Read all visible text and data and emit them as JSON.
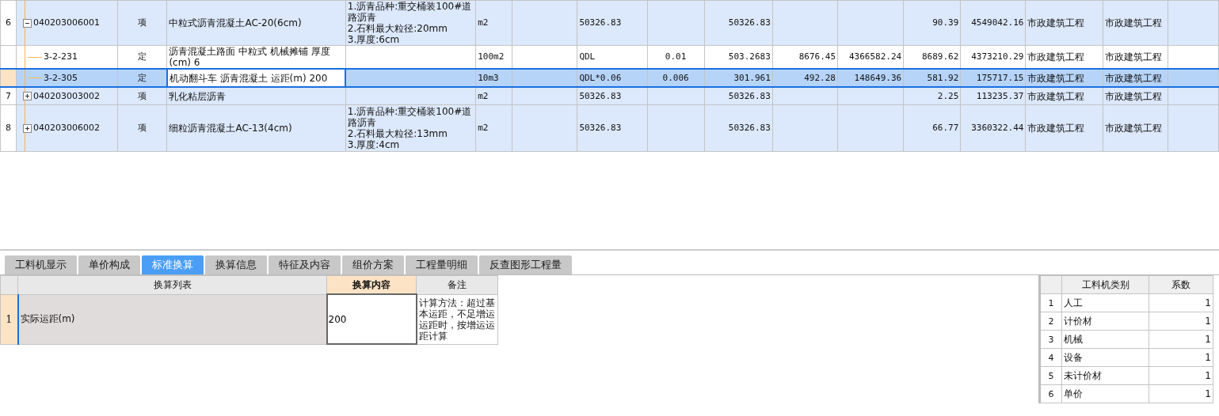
{
  "table": {
    "rows": [
      {
        "number": "6",
        "expanded": true,
        "selected": false,
        "code": "040203006001",
        "type": "项",
        "name": "中粒式沥青混凝土AC-20(6cm)",
        "feature": "1.沥青品种:重交桶装100#道路沥青\n2.石料最大粒径:20mm\n3.厚度:6cm",
        "unit": "m2",
        "expression": "50326.83",
        "quantity": "50326.83",
        "column_13": "90.39",
        "column_14": "4549042.16",
        "column_15": "市政建筑工程",
        "column_16": "市政建筑工程",
        "children": [
          {
            "selected": false,
            "code": "3-2-231",
            "type": "定",
            "name": "沥青混凝土路面 中粒式 机械摊铺 厚度(cm) 6",
            "unit": "100m2",
            "expression": "QDL",
            "content": "0.01",
            "quantity": "503.2683",
            "column_11": "8676.45",
            "column_12": "4366582.24",
            "column_13": "8689.62",
            "column_14": "4373210.29",
            "column_15": "市政建筑工程",
            "column_16": "市政建筑工程"
          },
          {
            "selected": true,
            "code": "3-2-305",
            "type": "定",
            "name": "机动翻斗车 沥青混凝土 运距(m) 200",
            "unit": "10m3",
            "expression": "QDL*0.06",
            "content": "0.006",
            "quantity": "301.961",
            "column_11": "492.28",
            "column_12": "148649.36",
            "column_13": "581.92",
            "column_14": "175717.15",
            "column_15": "市政建筑工程",
            "column_16": "市政建筑工程"
          }
        ]
      },
      {
        "number": "7",
        "expanded": false,
        "selected": false,
        "code": "040203003002",
        "type": "项",
        "name": "乳化粘层沥青",
        "unit": "m2",
        "expression": "50326.83",
        "quantity": "50326.83",
        "column_13": "2.25",
        "column_14": "113235.37",
        "column_15": "市政建筑工程",
        "column_16": "市政建筑工程"
      },
      {
        "number": "8",
        "expanded": false,
        "selected": false,
        "code": "040203006002",
        "type": "项",
        "name": "细粒沥青混凝土AC-13(4cm)",
        "feature": "1.沥青品种:重交桶装100#道路沥青\n2.石料最大粒径:13mm\n3.厚度:4cm",
        "unit": "m2",
        "expression": "50326.83",
        "quantity": "50326.83",
        "column_13": "66.77",
        "column_14": "3360322.44",
        "column_15": "市政建筑工程",
        "column_16": "市政建筑工程"
      }
    ]
  },
  "tabs": [
    {
      "label": "工料机显示",
      "selected": false
    },
    {
      "label": "单价构成",
      "selected": false
    },
    {
      "label": "标准换算",
      "selected": true
    },
    {
      "label": "换算信息",
      "selected": false
    },
    {
      "label": "特征及内容",
      "selected": false
    },
    {
      "label": "组价方案",
      "selected": false
    },
    {
      "label": "工程量明细",
      "selected": false
    },
    {
      "label": "反查图形工程量",
      "selected": false
    }
  ],
  "conversion": {
    "columns": [
      "换算列表",
      "换算内容",
      "备注"
    ],
    "rows": [
      {
        "number": "1",
        "item": "实际运距(m)",
        "value": "200",
        "note": "计算方法：超过基本运距，不足增运运距时，按增运运距计算"
      }
    ]
  },
  "coefficients": {
    "columns": [
      "工料机类别",
      "系数"
    ],
    "rows": [
      {
        "number": "1",
        "category": "人工",
        "factor": "1"
      },
      {
        "number": "2",
        "category": "计价材",
        "factor": "1"
      },
      {
        "number": "3",
        "category": "机械",
        "factor": "1"
      },
      {
        "number": "4",
        "category": "设备",
        "factor": "1"
      },
      {
        "number": "5",
        "category": "未计价材",
        "factor": "1"
      },
      {
        "number": "6",
        "category": "单价",
        "factor": "1"
      }
    ]
  }
}
